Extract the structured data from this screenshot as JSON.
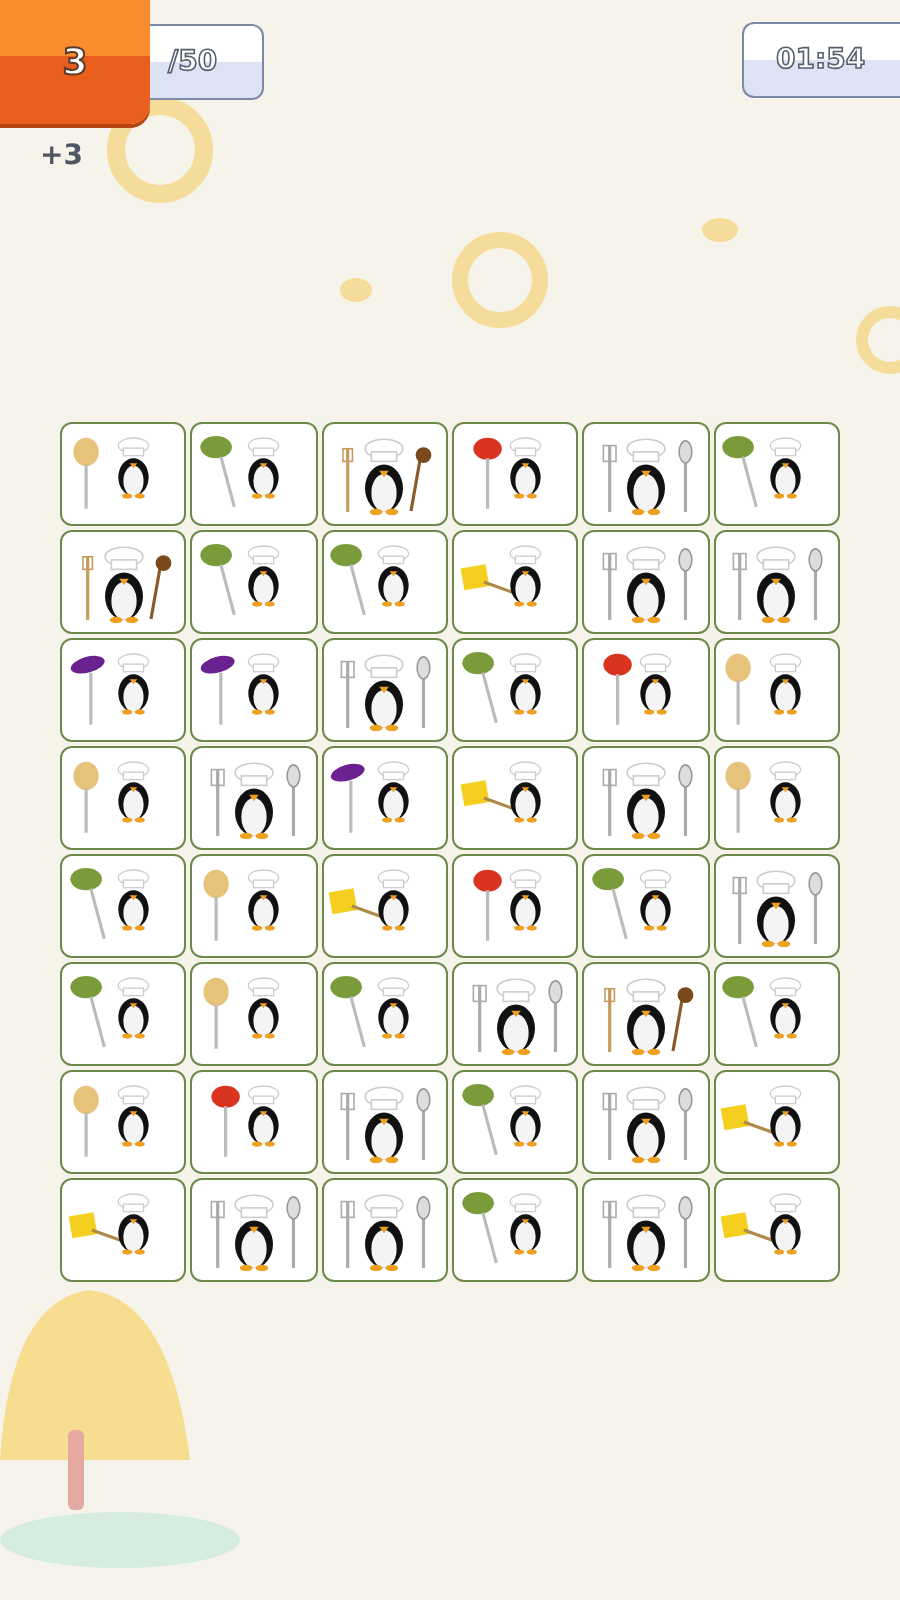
{
  "score": {
    "current": "3",
    "target": "/50",
    "bonus": "+3"
  },
  "timer": "01:54",
  "board": [
    [
      {
        "kind": "potato"
      },
      {
        "kind": "olive"
      },
      {
        "kind": "wooden"
      },
      {
        "kind": "tomato"
      },
      {
        "kind": "silver"
      },
      {
        "kind": "olive"
      }
    ],
    [
      {
        "kind": "wooden"
      },
      {
        "kind": "olive"
      },
      {
        "kind": "olive"
      },
      {
        "kind": "cheese"
      },
      {
        "kind": "silver"
      },
      {
        "kind": "silver"
      }
    ],
    [
      {
        "kind": "eggplant"
      },
      {
        "kind": "eggplant"
      },
      {
        "kind": "silver"
      },
      {
        "kind": "olive"
      },
      {
        "kind": "tomato"
      },
      {
        "kind": "potato"
      }
    ],
    [
      {
        "kind": "potato"
      },
      {
        "kind": "silver"
      },
      {
        "kind": "eggplant"
      },
      {
        "kind": "cheese"
      },
      {
        "kind": "silver"
      },
      {
        "kind": "potato"
      }
    ],
    [
      {
        "kind": "olive"
      },
      {
        "kind": "potato"
      },
      {
        "kind": "cheese"
      },
      {
        "kind": "tomato"
      },
      {
        "kind": "olive"
      },
      {
        "kind": "silver"
      }
    ],
    [
      {
        "kind": "olive"
      },
      {
        "kind": "potato"
      },
      {
        "kind": "olive"
      },
      {
        "kind": "silver"
      },
      {
        "kind": "wooden"
      },
      {
        "kind": "olive"
      }
    ],
    [
      {
        "kind": "potato"
      },
      {
        "kind": "tomato"
      },
      {
        "kind": "silver"
      },
      {
        "kind": "olive"
      },
      {
        "kind": "silver"
      },
      {
        "kind": "cheese"
      }
    ],
    [
      {
        "kind": "cheese"
      },
      {
        "kind": "silver"
      },
      {
        "kind": "silver"
      },
      {
        "kind": "olive"
      },
      {
        "kind": "silver"
      },
      {
        "kind": "cheese"
      }
    ]
  ]
}
